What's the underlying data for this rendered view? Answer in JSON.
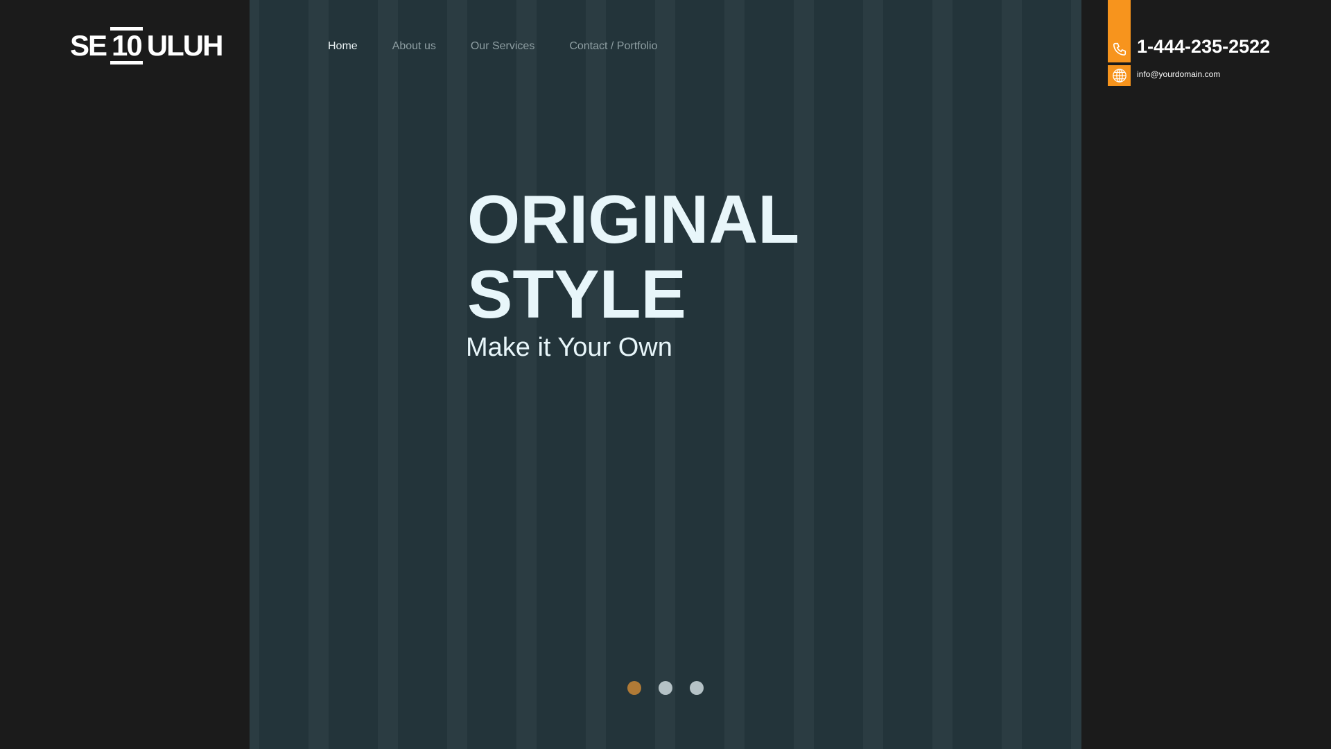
{
  "logo": {
    "part1": "SE",
    "part2": "10",
    "part3": "ULUH"
  },
  "nav": [
    {
      "label": "Home",
      "active": true
    },
    {
      "label": "About us"
    },
    {
      "label": "Our Services"
    },
    {
      "label": "Contact / Portfolio"
    }
  ],
  "contact": {
    "phone": "1-444-235-2522",
    "email": "info@yourdomain.com",
    "phone_icon": "phone-icon",
    "email_icon": "globe-icon"
  },
  "hero": {
    "line1": "ORIGINAL",
    "line2": "STYLE",
    "subtitle": "Make it Your Own"
  },
  "slider": {
    "count": 3,
    "active": 1
  },
  "colors": {
    "accent": "#f7941d",
    "dot_active": "#b07a36",
    "panel": "#1b1b1b"
  }
}
